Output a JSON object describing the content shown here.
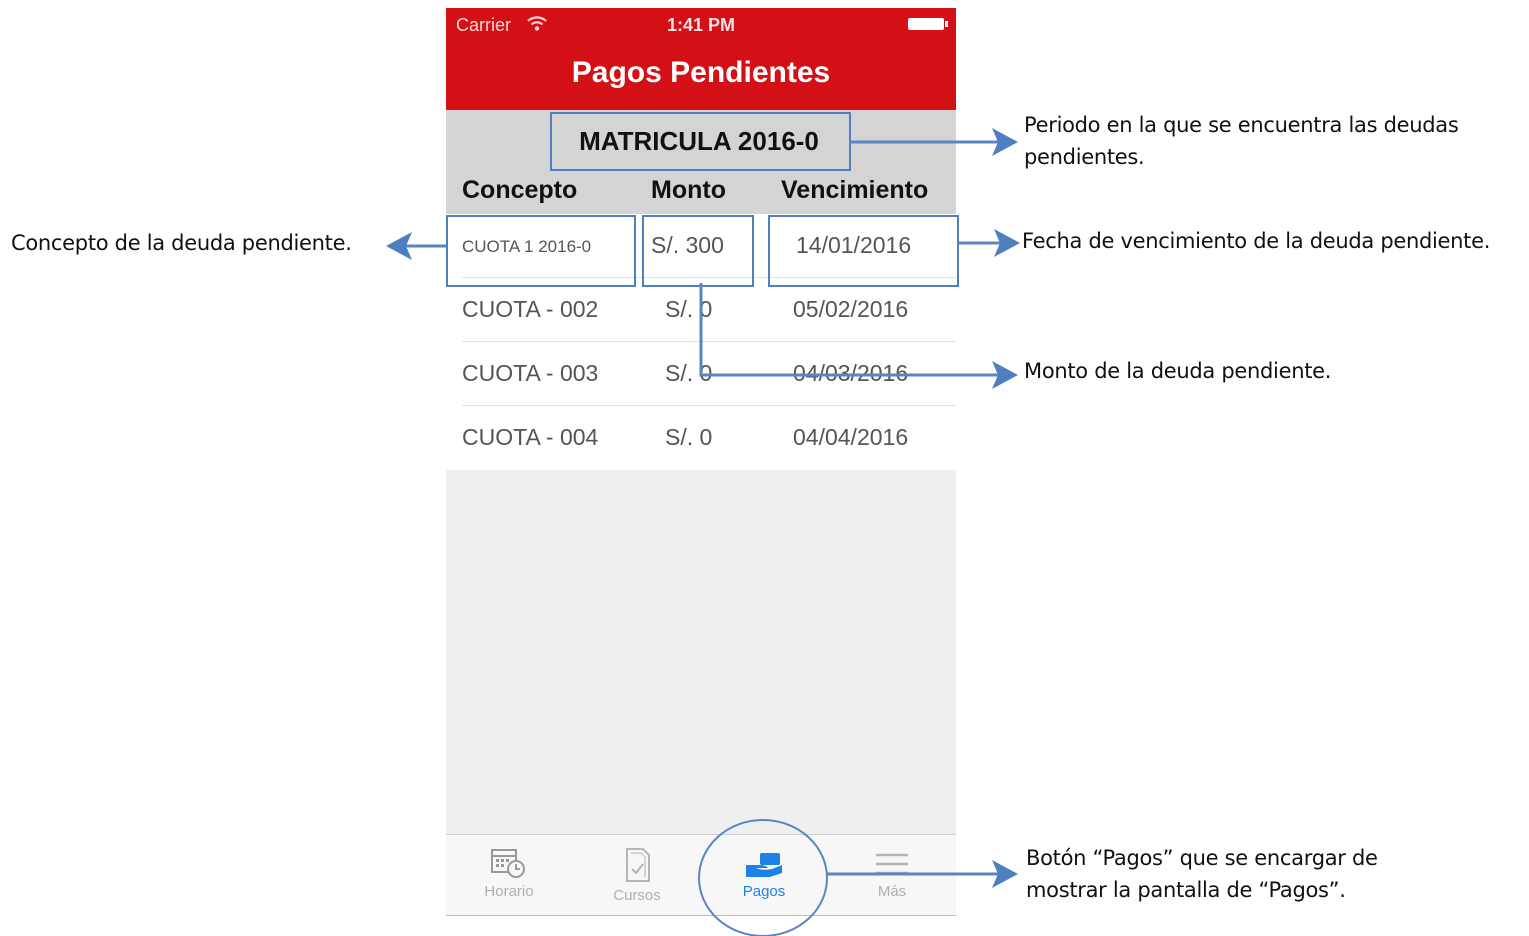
{
  "status_bar": {
    "carrier": "Carrier",
    "time": "1:41 PM"
  },
  "nav": {
    "title": "Pagos Pendientes"
  },
  "period": "MATRICULA 2016-0",
  "table": {
    "headers": {
      "concepto": "Concepto",
      "monto": "Monto",
      "vencimiento": "Vencimiento"
    },
    "rows": [
      {
        "concepto": "CUOTA 1 2016-0",
        "monto": "S/. 300",
        "vencimiento": "14/01/2016"
      },
      {
        "concepto": "CUOTA - 002",
        "monto": "S/. 0",
        "vencimiento": "05/02/2016"
      },
      {
        "concepto": "CUOTA - 003",
        "monto": "S/. 0",
        "vencimiento": "04/03/2016"
      },
      {
        "concepto": "CUOTA - 004",
        "monto": "S/. 0",
        "vencimiento": "04/04/2016"
      }
    ]
  },
  "tabs": [
    {
      "label": "Horario",
      "icon": "calendar-clock-icon",
      "active": false
    },
    {
      "label": "Cursos",
      "icon": "document-check-icon",
      "active": false
    },
    {
      "label": "Pagos",
      "icon": "hand-money-icon",
      "active": true
    },
    {
      "label": "Más",
      "icon": "menu-icon",
      "active": false
    }
  ],
  "annotations": {
    "periodo": "Periodo en  la que se encuentra las deudas pendientes.",
    "concepto": "Concepto  de  la deuda pendiente.",
    "fecha": "Fecha de vencimiento  de la deuda pendiente.",
    "monto": "Monto  de la deuda pendiente.",
    "boton": "Botón  “Pagos” que se encargar de mostrar la pantalla de “Pagos”."
  },
  "colors": {
    "nav_red": "#d21016",
    "annotation_blue": "#4f7fbf",
    "tab_active": "#1d82e6"
  }
}
